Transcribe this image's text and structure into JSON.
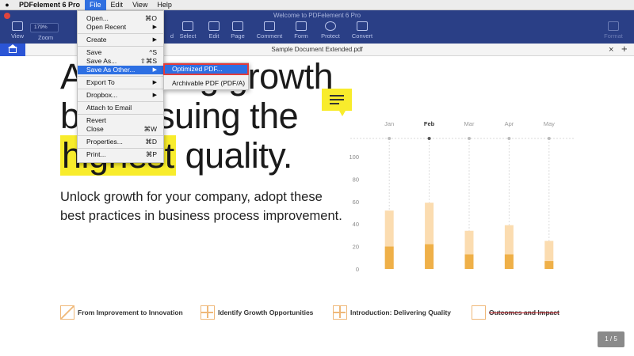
{
  "menubar": {
    "items": [
      "PDFelement 6 Pro",
      "File",
      "Edit",
      "View",
      "Help"
    ],
    "active": "File"
  },
  "window": {
    "title": "Welcome to PDFelement 6 Pro"
  },
  "toolbar": {
    "view_label": "View",
    "zoom_value": "179%",
    "zoom_label": "Zoom",
    "tools": [
      "d",
      "Select",
      "Edit",
      "Page",
      "Comment",
      "Form",
      "Protect",
      "Convert"
    ],
    "format_label": "Format"
  },
  "tabs": {
    "document_title": "Sample Document Extended.pdf",
    "close_glyph": "×",
    "add_glyph": "+"
  },
  "file_menu": {
    "items": [
      {
        "label": "Open...",
        "shortcut": "⌘O"
      },
      {
        "label": "Open Recent",
        "submenu": true
      },
      {
        "label": "Create",
        "submenu": true
      },
      {
        "label": "Save",
        "shortcut": "^S"
      },
      {
        "label": "Save As...",
        "shortcut": "⇧⌘S"
      },
      {
        "label": "Save As Other...",
        "submenu": true,
        "highlighted": true
      },
      {
        "label": "Export To",
        "submenu": true
      },
      {
        "label": "Dropbox...",
        "submenu": true
      },
      {
        "label": "Attach to Email"
      },
      {
        "label": "Revert"
      },
      {
        "label": "Close",
        "shortcut": "⌘W"
      },
      {
        "label": "Properties...",
        "shortcut": "⌘D"
      },
      {
        "label": "Print...",
        "shortcut": "⌘P"
      }
    ]
  },
  "save_as_other_submenu": {
    "items": [
      "Optimized PDF...",
      "Archivable PDF (PDF/A)"
    ],
    "selected": "Optimized PDF..."
  },
  "document": {
    "heading_line1": "A",
    "heading_line1_rest": "ing growth",
    "heading_line2": "by pursuing the",
    "heading_line3_highlight": "highest",
    "heading_line3_rest": " quality.",
    "subtext": "Unlock growth for your company, adopt these best practices in business process improvement.",
    "footer_items": [
      "From Improvement to Innovation",
      "Identify Growth Opportunities",
      "Introduction: Delivering Quality",
      "Outcomes and Impact"
    ],
    "page_indicator": "1 / 5"
  },
  "colors": {
    "toolbar": "#2a3f86",
    "highlight": "#f8ec2c",
    "bar_light": "#fbdcb0",
    "bar_dark": "#efb048",
    "menu_selection": "#2d6fe3"
  },
  "chart_data": {
    "type": "bar",
    "categories": [
      "Jan",
      "Feb",
      "Mar",
      "Apr",
      "May"
    ],
    "highlighted_category": "Feb",
    "y_ticks": [
      0,
      20,
      40,
      60,
      80,
      100
    ],
    "ylim": [
      0,
      100
    ],
    "series": [
      {
        "values": [
          52,
          59,
          34,
          39,
          25
        ]
      },
      {
        "values": [
          20,
          22,
          13,
          13,
          7
        ]
      }
    ]
  }
}
